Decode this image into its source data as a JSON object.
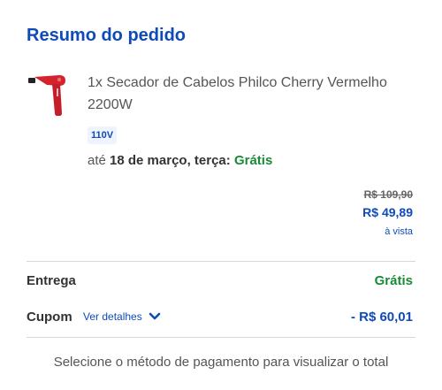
{
  "summary": {
    "title": "Resumo do pedido"
  },
  "product": {
    "image_icon": "hair-dryer-image",
    "image_color": "#d2232f",
    "name": "1x Secador de Cabelos Philco Cherry Vermelho 2200W",
    "voltage": "110V",
    "delivery_prefix": "até",
    "delivery_date": "18 de março, terça:",
    "delivery_cost": "Grátis",
    "price_original": "R$ 109,90",
    "price_current": "R$ 49,89",
    "price_note": "à vista"
  },
  "totals": {
    "shipping_label": "Entrega",
    "shipping_value": "Grátis",
    "coupon_label": "Cupom",
    "coupon_details_link": "Ver detalhes",
    "coupon_details_icon": "chevron-down-icon",
    "coupon_value": "- R$ 60,01"
  },
  "footer": {
    "message": "Selecione o método de pagamento para visualizar o total"
  },
  "colors": {
    "brand_blue": "#0f4bb8",
    "success_green": "#1b8a37",
    "divider": "#d7d7d7"
  }
}
